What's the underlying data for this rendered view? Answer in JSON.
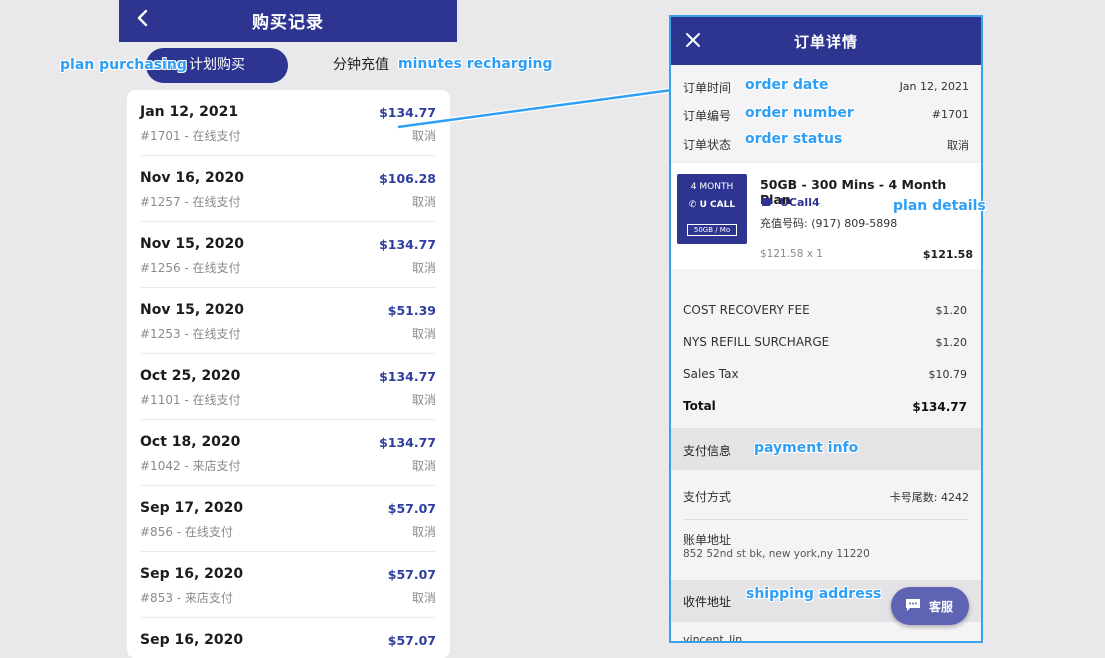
{
  "left_screen": {
    "header": {
      "title": "购买记录"
    },
    "tabs": {
      "active": "计划购买",
      "inactive": "分钟充值"
    },
    "orders": [
      {
        "date": "Jan 12, 2021",
        "amount": "$134.77",
        "sub": "#1701 - 在线支付",
        "status": "取消"
      },
      {
        "date": "Nov 16, 2020",
        "amount": "$106.28",
        "sub": "#1257 - 在线支付",
        "status": "取消"
      },
      {
        "date": "Nov 15, 2020",
        "amount": "$134.77",
        "sub": "#1256 - 在线支付",
        "status": "取消"
      },
      {
        "date": "Nov 15, 2020",
        "amount": "$51.39",
        "sub": "#1253 - 在线支付",
        "status": "取消"
      },
      {
        "date": "Oct 25, 2020",
        "amount": "$134.77",
        "sub": "#1101 - 在线支付",
        "status": "取消"
      },
      {
        "date": "Oct 18, 2020",
        "amount": "$134.77",
        "sub": "#1042 - 来店支付",
        "status": "取消"
      },
      {
        "date": "Sep 17, 2020",
        "amount": "$57.07",
        "sub": "#856 - 在线支付",
        "status": "取消"
      },
      {
        "date": "Sep 16, 2020",
        "amount": "$57.07",
        "sub": "#853 - 来店支付",
        "status": "取消"
      },
      {
        "date": "Sep 16, 2020",
        "amount": "$57.07",
        "sub": "",
        "status": ""
      }
    ]
  },
  "annotations": {
    "plan_purchasing": "plan purchasing",
    "minutes_recharging": "minutes recharging",
    "order_date": "order date",
    "order_number": "order number",
    "order_status": "order status",
    "plan_details": "plan details",
    "payment_info": "payment info",
    "shipping_address": "shipping address"
  },
  "right_screen": {
    "header": {
      "title": "订单详情"
    },
    "meta": [
      {
        "label": "订单时间",
        "value": "Jan 12, 2021"
      },
      {
        "label": "订单编号",
        "value": "#1701"
      },
      {
        "label": "订单状态",
        "value": "取消"
      }
    ],
    "plan": {
      "image_month": "4 MONTH",
      "image_brand": "U CALL",
      "image_data": "50GB / Mo",
      "name": "50GB - 300 Mins - 4 Month Plan",
      "brand": "UCall4",
      "phone": "充值号码: (917) 809-5898",
      "qty": "$121.58 x 1",
      "price": "$121.58"
    },
    "fees": [
      {
        "label": "COST RECOVERY FEE",
        "value": "$1.20"
      },
      {
        "label": "NYS REFILL SURCHARGE",
        "value": "$1.20"
      },
      {
        "label": "Sales Tax",
        "value": "$10.79"
      },
      {
        "label": "Total",
        "value": "$134.77"
      }
    ],
    "payment": {
      "section_title": "支付信息",
      "method_label": "支付方式",
      "method_value": "卡号尾数: 4242",
      "bill_label": "账单地址",
      "bill_value": "852 52nd st bk, new york,ny 11220"
    },
    "shipping": {
      "section_title": "收件地址",
      "name": "vincent_lin"
    },
    "cs_button": "客服"
  },
  "colors": {
    "brand": "#2d3590",
    "amount": "#2f3e9e",
    "annotation": "#2f9ff5"
  }
}
